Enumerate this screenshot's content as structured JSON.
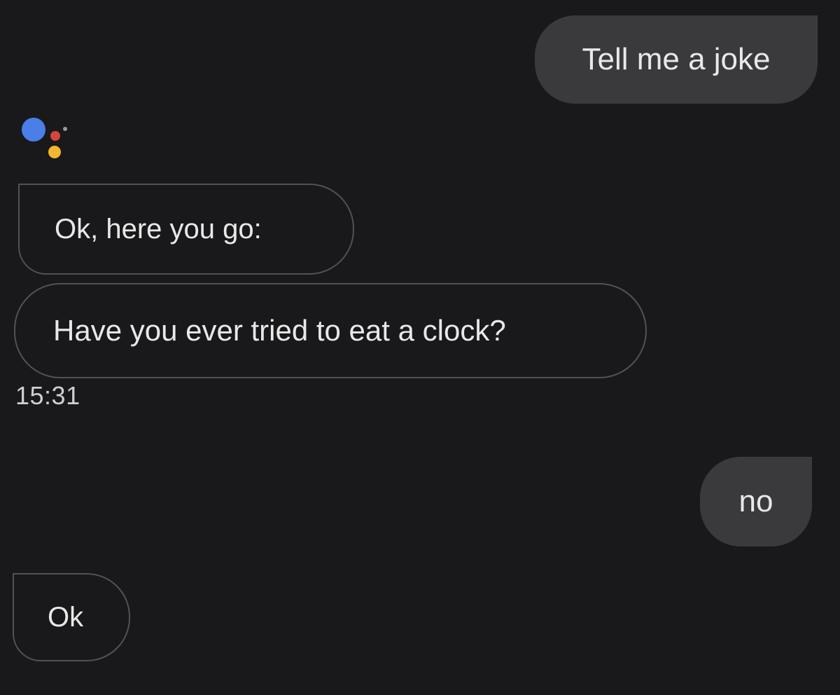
{
  "conversation": {
    "messages": [
      {
        "sender": "user",
        "text": "Tell me a joke"
      },
      {
        "sender": "assistant",
        "text": "Ok, here you go:"
      },
      {
        "sender": "assistant",
        "text": "Have you ever tried to eat a clock?"
      },
      {
        "sender": "user",
        "text": "no"
      },
      {
        "sender": "assistant",
        "text": "Ok"
      }
    ],
    "timestamp": "15:31"
  },
  "icons": {
    "assistant_logo": "google-assistant-icon"
  },
  "colors": {
    "background": "#19191b",
    "user_bubble": "#3a3a3d",
    "assistant_bubble_border": "#525256",
    "logo_blue": "#4a7fe8",
    "logo_red": "#d6453d",
    "logo_yellow": "#f2b62f",
    "logo_gray": "#9a9a9a"
  }
}
